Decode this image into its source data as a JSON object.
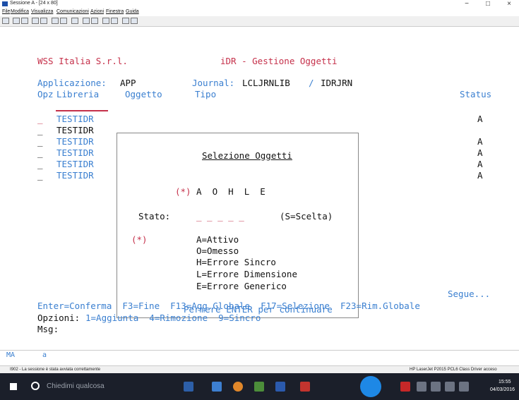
{
  "window": {
    "title": "Sessione A - [24 x 80]",
    "minimize": "−",
    "maximize": "□",
    "close": "×"
  },
  "menu": [
    "File",
    "Modifica",
    "Visualizza",
    "Comunicazioni",
    "Azioni",
    "Finestra",
    "Guida"
  ],
  "terminal": {
    "company": "WSS Italia S.r.l.",
    "screen_title": "iDR - Gestione Oggetti",
    "app_label": "Applicazione:",
    "app_value": "APP",
    "journal_label": "Journal:",
    "journal_value": "LCLJRNLIB",
    "journal_sep": "/",
    "journal_value2": "IDRJRN",
    "col_opz": "Opz",
    "col_libreria": "Libreria",
    "col_oggetto": "Oggetto",
    "col_tipo": "Tipo",
    "col_status": "Status",
    "rows": [
      {
        "lib": "TESTIDR",
        "status": "A"
      },
      {
        "lib": "TESTIDR",
        "status": ""
      },
      {
        "lib": "TESTIDR",
        "status": "A"
      },
      {
        "lib": "TESTIDR",
        "status": "A"
      },
      {
        "lib": "TESTIDR",
        "status": "A"
      },
      {
        "lib": "TESTIDR",
        "status": "A"
      }
    ],
    "row_marker": "_",
    "segue": "Segue...",
    "fkeys": "Enter=Conferma  F3=Fine  F13=Agg.Globale  F17=Selezione  F23=Rim.Globale",
    "opzioni_label": "Opzioni:",
    "opzioni_values": "1=Aggiunta  4=Rimozione  9=Sincro",
    "msg_label": "Msg:"
  },
  "dialog": {
    "title": "Selezione Oggetti",
    "star": "(*)",
    "letters": "A  O  H  L  E",
    "stato_label": "Stato:",
    "stato_blanks": "_ _ _ _ _",
    "stato_hint": "(S=Scelta)",
    "legend_star": "(*)",
    "legend": [
      "A=Attivo",
      "O=Omesso",
      "H=Errore Sincro",
      "L=Errore Dimensione",
      "E=Errore Generico"
    ],
    "footer": "Permere ENTER per continuare"
  },
  "bottom": {
    "ma_label": "MA",
    "ma_value": "a",
    "status_left": "I902 - La sessione è stata avviata correttamente",
    "status_right": "HP LaserJet P2015 PCL6 Class Driver acceso"
  },
  "taskbar": {
    "search": "Chiedimi qualcosa",
    "time": "15:55",
    "date": "04/03/2016"
  }
}
